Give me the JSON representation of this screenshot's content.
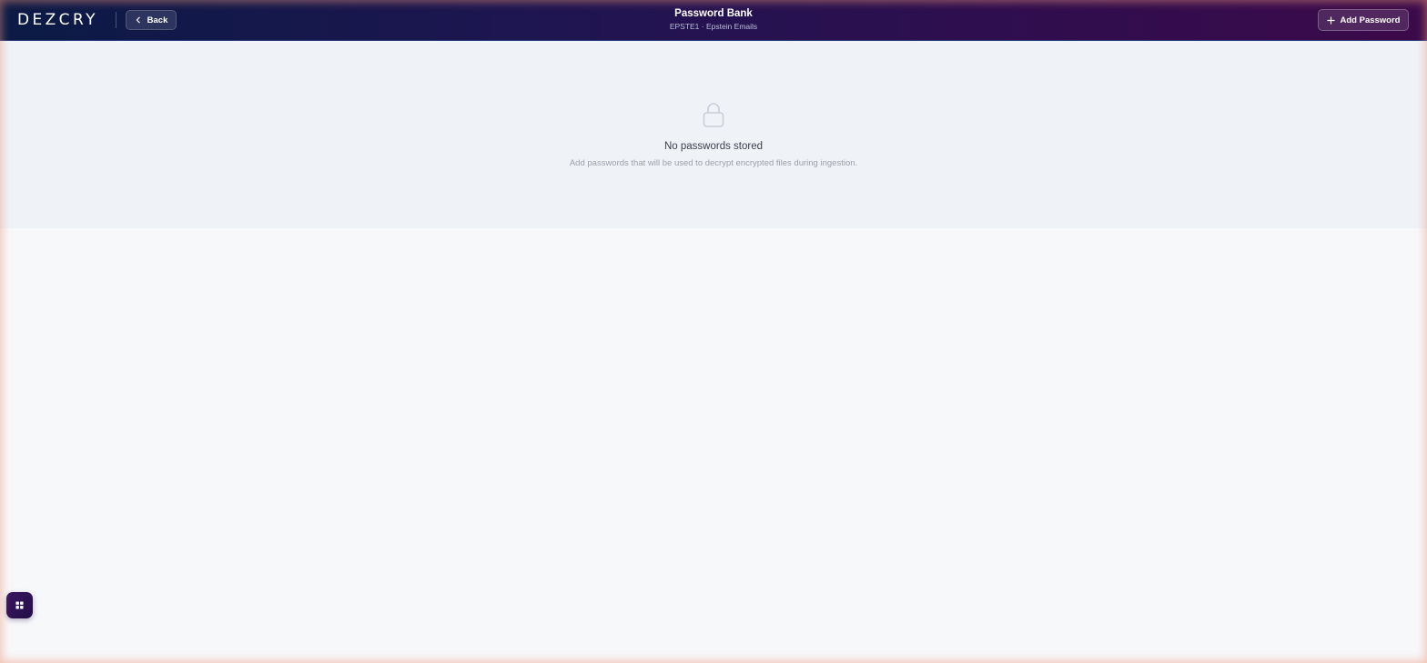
{
  "header": {
    "logo_text": "DEZCRY",
    "back_label": "Back",
    "title": "Password Bank",
    "subtitle": "EPSTE1 · Epstein Emails",
    "add_password_label": "Add Password"
  },
  "empty_state": {
    "icon": "lock-icon",
    "title": "No passwords stored",
    "description": "Add passwords that will be used to decrypt encrypted files during ingestion."
  },
  "floating": {
    "apps_icon": "grid-icon"
  },
  "colors": {
    "header_start": "#0b1a45",
    "header_end": "#3b0a4a",
    "panel_bg": "#eff2f7",
    "page_bg": "#f7f8fa"
  }
}
